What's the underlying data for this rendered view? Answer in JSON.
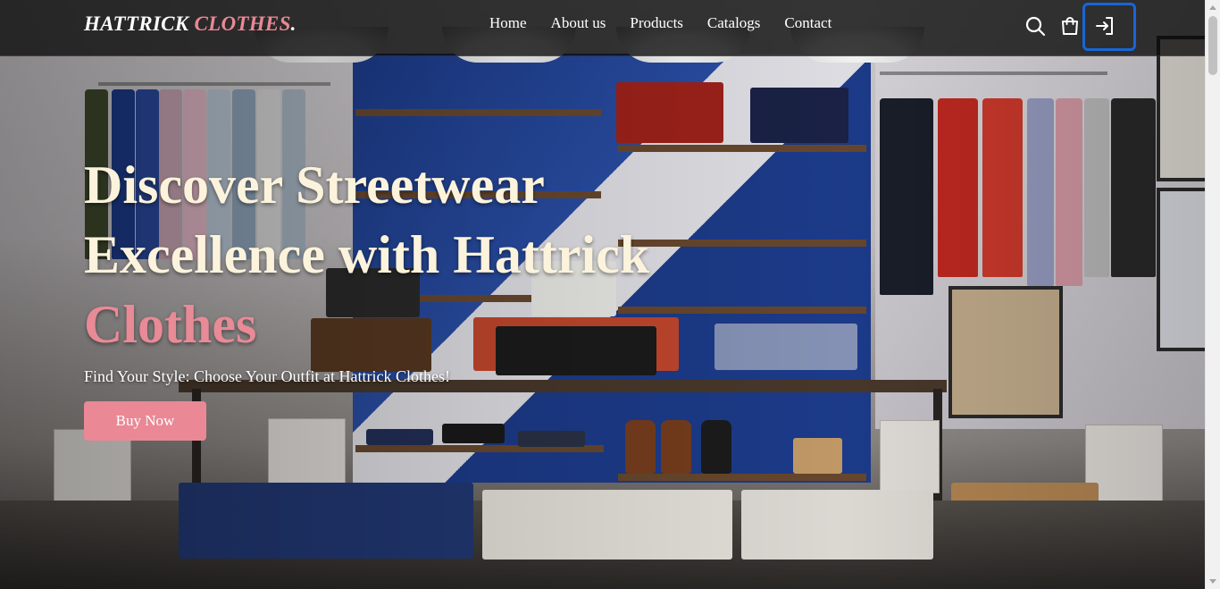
{
  "brand": {
    "name_main": "HATTRICK ",
    "name_accent": "CLOTHES",
    "name_suffix": "."
  },
  "nav": {
    "items": [
      {
        "label": "Home"
      },
      {
        "label": "About us"
      },
      {
        "label": "Products"
      },
      {
        "label": "Catalogs"
      },
      {
        "label": "Contact"
      }
    ]
  },
  "header_icons": {
    "search": "search-icon",
    "cart": "shopping-bag-icon",
    "login": "login-icon"
  },
  "hero": {
    "title_line1": "Discover Streetwear",
    "title_line2": "Excellence with Hattrick",
    "title_accent": "Clothes",
    "subtitle": "Find Your Style: Choose Your Outfit at Hattrick Clothes!",
    "cta_label": "Buy Now"
  },
  "colors": {
    "accent_pink": "#ea8895",
    "focus_blue": "#1766d6",
    "header_bg": "#0a0a0a",
    "hero_text": "#fbf3dc"
  }
}
